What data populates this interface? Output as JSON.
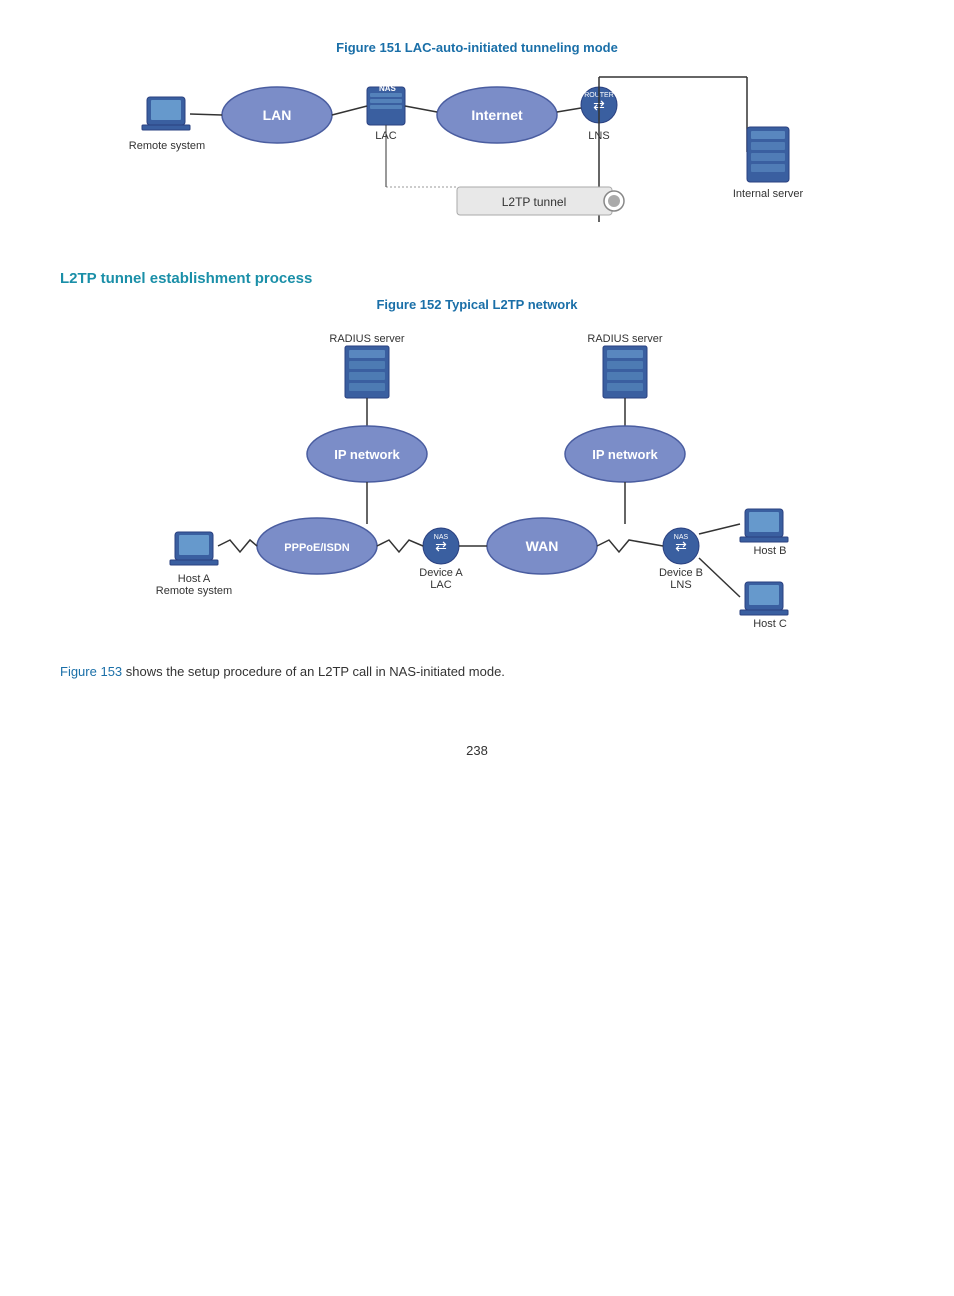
{
  "fig151": {
    "caption": "Figure 151 LAC-auto-initiated tunneling mode",
    "labels": {
      "remote_system": "Remote system",
      "lan": "LAN",
      "nas": "NAS",
      "internet": "Internet",
      "lac": "LAC",
      "lns": "LNS",
      "l2tp_tunnel": "L2TP tunnel",
      "internal_server": "Internal server"
    }
  },
  "section_heading": "L2TP tunnel establishment process",
  "fig152": {
    "caption": "Figure 152 Typical L2TP network",
    "labels": {
      "radius_server_left": "RADIUS server",
      "radius_server_right": "RADIUS server",
      "ip_network_left": "IP network",
      "ip_network_right": "IP network",
      "ppoe_isdn": "PPPoE/ISDN",
      "wan": "WAN",
      "host_a": "Host A",
      "remote_system": "Remote system",
      "device_a": "Device A",
      "lac": "LAC",
      "device_b": "Device B",
      "lns": "LNS",
      "host_b": "Host B",
      "host_c": "Host C"
    }
  },
  "body_text": {
    "ref": "Figure 153",
    "text": " shows the setup procedure of an L2TP call in NAS-initiated mode."
  },
  "page_number": "238"
}
